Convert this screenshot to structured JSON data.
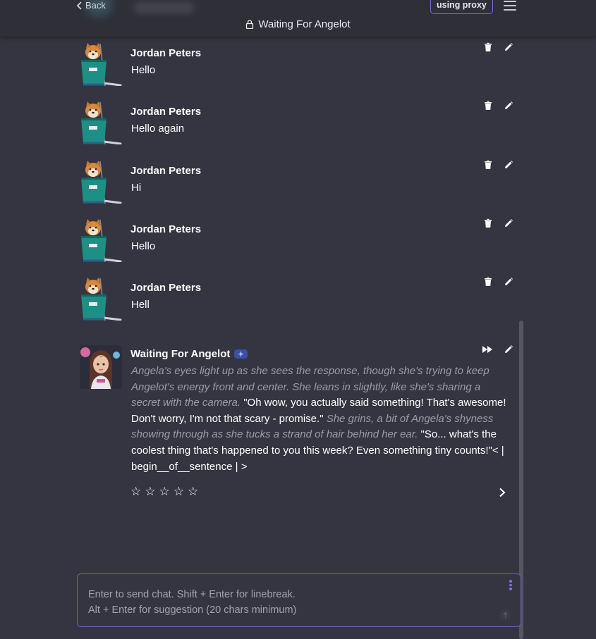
{
  "header": {
    "back_label": "Back",
    "title": "Waiting For Angelot",
    "proxy_label": "using proxy"
  },
  "messages": [
    {
      "name": "Jordan Peters",
      "text": "Hello"
    },
    {
      "name": "Jordan Peters",
      "text": "Hello again"
    },
    {
      "name": "Jordan Peters",
      "text": "Hi"
    },
    {
      "name": "Jordan Peters",
      "text": "Hello"
    },
    {
      "name": "Jordan Peters",
      "text": "Hell"
    }
  ],
  "bot": {
    "name": "Waiting For Angelot",
    "parts": [
      {
        "style": "action",
        "text": "Angela's eyes light up as she sees the response, though she's trying to keep Angelot's energy front and center. She leans in slightly, like she's sharing a secret with the camera."
      },
      {
        "style": "speech",
        "text": "\"Oh wow, you actually said something! That's awesome! Don't worry, I'm not that scary - promise.\""
      },
      {
        "style": "action",
        "text": "She grins, a bit of Angela's shyness showing through as she tucks a strand of hair behind her ear."
      },
      {
        "style": "speech",
        "text": "\"So... what's the coolest thing that's happened to you this week? Even something tiny counts!\"< | begin__of__sentence | >"
      }
    ],
    "rating_stars": 5,
    "rating_value": 0
  },
  "input": {
    "placeholder": "Enter to send chat. Shift + Enter for linebreak.\nAlt + Enter for suggestion (20 chars minimum)",
    "value": ""
  },
  "colors": {
    "background": "#343540",
    "accent": "#7b6bd6",
    "action_text": "#9b9ca4"
  }
}
